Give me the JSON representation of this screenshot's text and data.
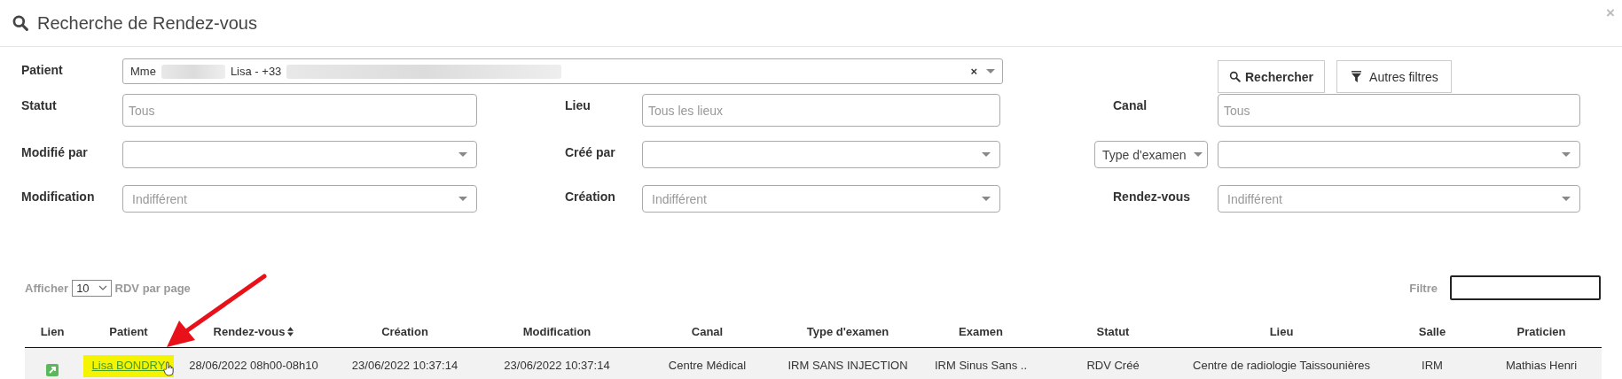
{
  "window": {
    "title": "Recherche de Rendez-vous",
    "close": "×"
  },
  "patient": {
    "label": "Patient",
    "prefix": "Mme",
    "value": "Lisa - +33",
    "clear": "×"
  },
  "buttons": [
    {
      "kind": "search",
      "label": "Rechercher"
    },
    {
      "kind": "filter",
      "label": "Autres filtres"
    }
  ],
  "filters": [
    {
      "kind": "input",
      "label": "Statut",
      "label_dropdown": false,
      "placeholder": "Tous"
    },
    {
      "kind": "input",
      "label": "Lieu",
      "label_dropdown": false,
      "placeholder": "Tous les lieux"
    },
    {
      "kind": "input",
      "label": "Canal",
      "label_dropdown": false,
      "placeholder": "Tous"
    },
    {
      "kind": "select",
      "label": "Modifié par",
      "label_dropdown": false
    },
    {
      "kind": "select",
      "label": "Créé par",
      "label_dropdown": false
    },
    {
      "kind": "select",
      "label": "Type d'examen",
      "label_dropdown": true
    },
    {
      "kind": "select",
      "label": "Modification",
      "label_dropdown": false,
      "placeholder": "Indifférent"
    },
    {
      "kind": "select",
      "label": "Création",
      "label_dropdown": false,
      "placeholder": "Indifférent"
    },
    {
      "kind": "select",
      "label": "Rendez-vous",
      "label_dropdown": false,
      "placeholder": "Indifférent"
    }
  ],
  "paging": {
    "before": "Afficher",
    "value": "10",
    "after": "RDV par page"
  },
  "filter_box": {
    "label": "Filtre"
  },
  "table": {
    "columns": [
      {
        "label": "Lien",
        "sortable": false
      },
      {
        "label": "Patient",
        "sortable": false
      },
      {
        "label": "Rendez-vous",
        "sortable": true
      },
      {
        "label": "Création",
        "sortable": false
      },
      {
        "label": "Modification",
        "sortable": false
      },
      {
        "label": "Canal",
        "sortable": false
      },
      {
        "label": "Type d'examen",
        "sortable": false
      },
      {
        "label": "Examen",
        "sortable": false
      },
      {
        "label": "Statut",
        "sortable": false
      },
      {
        "label": "Lieu",
        "sortable": false
      },
      {
        "label": "Salle",
        "sortable": false
      },
      {
        "label": "Praticien",
        "sortable": false
      }
    ],
    "rows": [
      {
        "cells": [
          {
            "kind": "icon"
          },
          {
            "kind": "link",
            "text": "Lisa BONDRY",
            "highlighted": true
          },
          {
            "kind": "text",
            "text": "28/06/2022 08h00-08h10",
            "highlighted": false
          },
          {
            "kind": "text",
            "text": "23/06/2022 10:37:14",
            "highlighted": false
          },
          {
            "kind": "text",
            "text": "23/06/2022 10:37:14",
            "highlighted": false
          },
          {
            "kind": "text",
            "text": "Centre Médical",
            "highlighted": false
          },
          {
            "kind": "text",
            "text": "IRM SANS INJECTION",
            "highlighted": false
          },
          {
            "kind": "text",
            "text": "IRM Sinus Sans ..",
            "highlighted": false
          },
          {
            "kind": "text",
            "text": "RDV Créé",
            "highlighted": false
          },
          {
            "kind": "text",
            "text": "Centre de radiologie Taissounières",
            "highlighted": false
          },
          {
            "kind": "text",
            "text": "IRM",
            "highlighted": false
          },
          {
            "kind": "text",
            "text": "Mathias Henri",
            "highlighted": false
          }
        ]
      }
    ]
  }
}
